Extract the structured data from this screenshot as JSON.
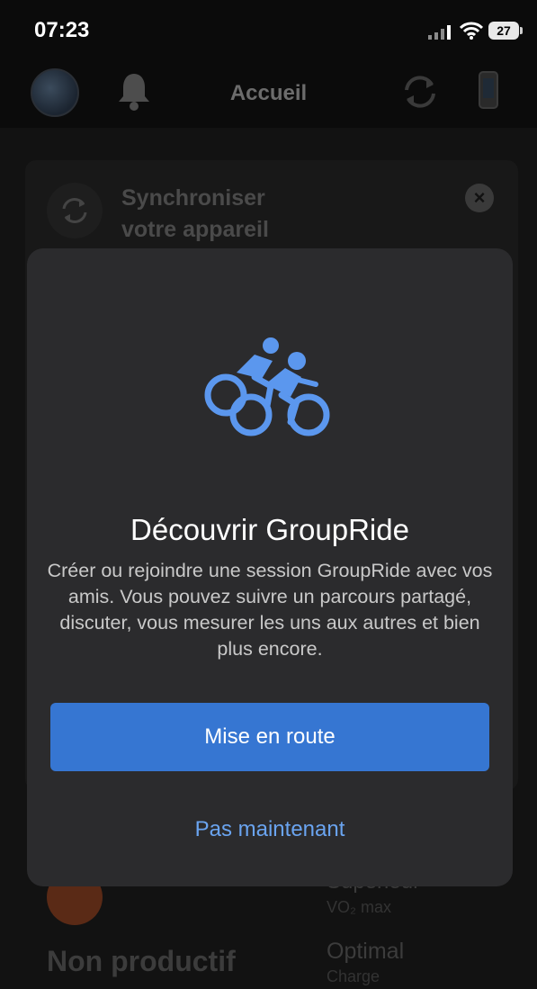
{
  "status_bar": {
    "time": "07:23",
    "battery": "27"
  },
  "header": {
    "title": "Accueil"
  },
  "background": {
    "sync_card": {
      "title_line1": "Synchroniser",
      "title_line2": "votre appareil"
    },
    "stats": {
      "status": "Non productif",
      "vo2_value": "Supérieur",
      "vo2_label": "VO₂ max",
      "load_value": "Optimal",
      "load_label": "Charge"
    }
  },
  "modal": {
    "title": "Découvrir GroupRide",
    "description": "Créer ou rejoindre une session GroupRide avec vos amis. Vous pouvez suivre un parcours partagé, discuter, vous mesurer les uns aux autres et bien plus encore.",
    "primary_button": "Mise en route",
    "secondary_button": "Pas maintenant",
    "icon": "group-cycling-icon"
  },
  "colors": {
    "accent": "#3676d2",
    "link": "#6aa4f0",
    "modal_bg": "#2b2b2d"
  }
}
